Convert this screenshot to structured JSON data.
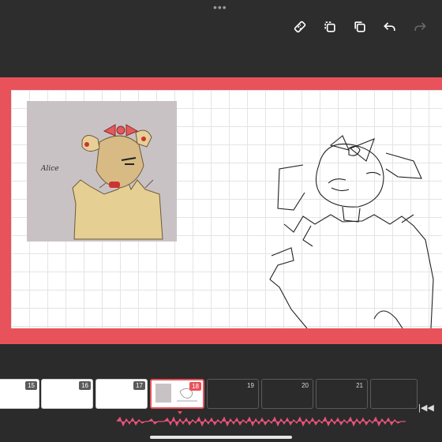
{
  "window": {
    "grip_label": "•••"
  },
  "toolbar": {
    "icons": [
      "ruler-icon",
      "copy-frame-icon",
      "duplicate-icon",
      "undo-icon",
      "redo-icon"
    ]
  },
  "canvas": {
    "reference_signature": "Alice"
  },
  "timeline": {
    "frames": [
      {
        "number": "15",
        "state": "filled"
      },
      {
        "number": "16",
        "state": "filled"
      },
      {
        "number": "17",
        "state": "filled"
      },
      {
        "number": "18",
        "state": "active"
      },
      {
        "number": "19",
        "state": "empty"
      },
      {
        "number": "20",
        "state": "empty"
      },
      {
        "number": "21",
        "state": "empty"
      }
    ],
    "rewind_label": "|◀◀"
  },
  "colors": {
    "accent": "#e8525a",
    "background": "#2b2b2b",
    "canvas": "#ffffff"
  }
}
